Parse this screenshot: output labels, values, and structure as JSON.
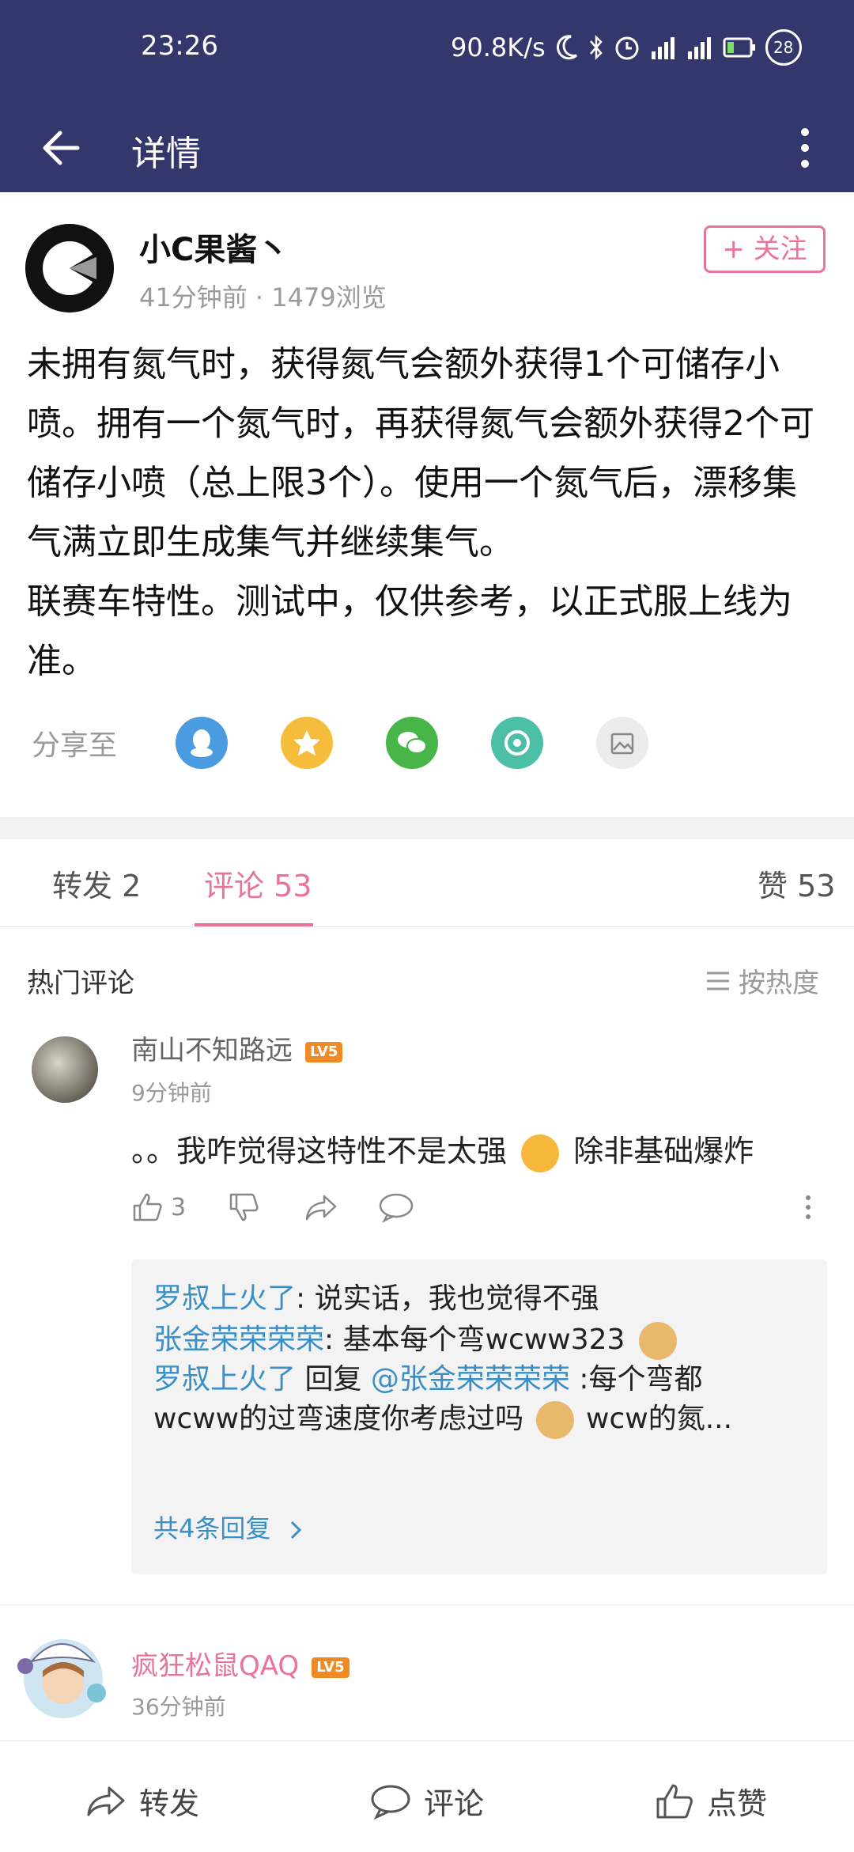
{
  "status_bar": {
    "time": "23:26",
    "net_speed": "90.8K/s",
    "battery": "28"
  },
  "header": {
    "title": "详情"
  },
  "post": {
    "author": "小C果酱丶",
    "time": "41分钟前",
    "views": "1479浏览",
    "follow_label": "+ 关注",
    "content": "未拥有氮气时，获得氮气会额外获得1个可储存小喷。拥有一个氮气时，再获得氮气会额外获得2个可储存小喷（总上限3个）。使用一个氮气后，漂移集气满立即生成集气并继续集气。\n联赛车特性。测试中，仅供参考，以正式服上线为准。",
    "share_label": "分享至",
    "share_targets": [
      "qq-icon",
      "qzone-icon",
      "wechat-icon",
      "moments-icon",
      "gallery-icon"
    ]
  },
  "tabs": [
    {
      "label": "转发 2"
    },
    {
      "label": "评论 53"
    },
    {
      "label": "赞 53"
    }
  ],
  "comments_section": {
    "title": "热门评论",
    "sort_label": "按热度"
  },
  "comments": [
    {
      "name": "南山不知路远",
      "level": "LV5",
      "time": "9分钟前",
      "text_a": "。。我咋觉得这特性不是太强",
      "text_b": "除非基础爆炸",
      "likes": "3",
      "replies": [
        {
          "name": "罗叔上火了",
          "text": ": 说实话，我也觉得不强"
        },
        {
          "name": "张金荣荣荣荣",
          "text": ": 基本每个弯wcww323"
        },
        {
          "name": "罗叔上火了",
          "reply_word": " 回复 ",
          "mention": "@张金荣荣荣荣",
          "text": " :每个弯都",
          "text2": "wcww的过弯速度你考虑过吗",
          "text3": " wcw的氮..."
        }
      ],
      "more_replies": "共4条回复"
    },
    {
      "name": "疯狂松鼠QAQ",
      "level": "LV5",
      "time": "36分钟前"
    }
  ],
  "bottom_bar": {
    "repost": "转发",
    "comment": "评论",
    "like": "点赞"
  },
  "colors": {
    "header_bg": "#33376b",
    "accent_pink": "#e8739b",
    "link_blue": "#3a8fc6"
  }
}
